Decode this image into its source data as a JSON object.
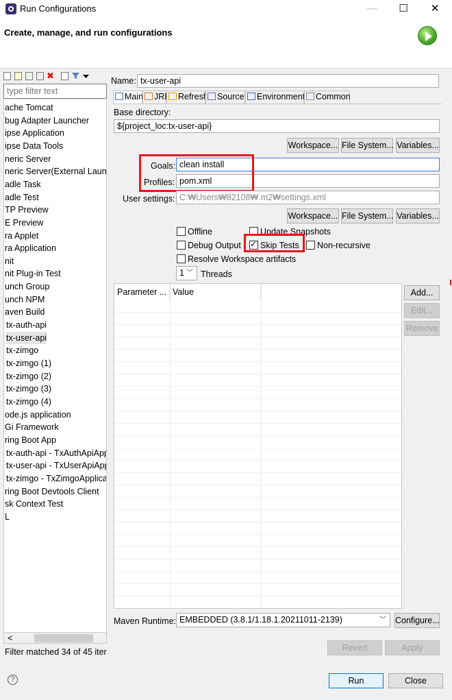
{
  "window": {
    "title": "Run Configurations",
    "min_glyph": "—",
    "max_glyph": "☐",
    "close_glyph": "✕"
  },
  "banner": {
    "heading": "Create, manage, and run configurations",
    "icon": "run-icon"
  },
  "left_panel": {
    "toolbar_icons": [
      "new-config-icon",
      "new-prototype-icon",
      "export-icon",
      "duplicate-icon",
      "delete-icon",
      "collapse-all-icon",
      "filter-icon",
      "view-menu-icon"
    ],
    "filter_placeholder": "type filter text",
    "tree_items": [
      "ache Tomcat",
      "bug Adapter Launcher",
      "ipse Application",
      "ipse Data Tools",
      "neric Server",
      "neric Server(External Launch",
      "adle Task",
      "adle Test",
      "TP Preview",
      "E Preview",
      "ra Applet",
      "ra Application",
      "nit",
      "nit Plug-in Test",
      "unch Group",
      "unch NPM",
      "aven Build",
      "tx-auth-api",
      "tx-user-api",
      "tx-zimgo",
      "tx-zimgo (1)",
      "tx-zimgo (2)",
      "tx-zimgo (3)",
      "tx-zimgo (4)",
      "ode.js application",
      "Gi Framework",
      "ring Boot App",
      "tx-auth-api - TxAuthApiApp",
      "tx-user-api - TxUserApiApp",
      "tx-zimgo - TxZimgoApplica",
      "ring Boot Devtools Client",
      "sk Context Test",
      "L"
    ],
    "selected_index": 18,
    "scroll_left_glyph": "<",
    "filter_status": "Filter matched 34 of 45 iter"
  },
  "config": {
    "name_label": "Name:",
    "name_value": "tx-user-api",
    "tabs": [
      {
        "label": "Main",
        "icon": "main-tab-icon"
      },
      {
        "label": "JRE",
        "icon": "jre-tab-icon"
      },
      {
        "label": "Refresh",
        "icon": "refresh-tab-icon"
      },
      {
        "label": "Source",
        "icon": "source-tab-icon"
      },
      {
        "label": "Environment",
        "icon": "environment-tab-icon"
      },
      {
        "label": "Common",
        "icon": "common-tab-icon"
      }
    ],
    "base_dir_label": "Base directory:",
    "base_dir_value": "${project_loc:tx-user-api}",
    "workspace_btn": "Workspace...",
    "filesystem_btn": "File System...",
    "variables_btn": "Variables...",
    "goals_label": "Goals:",
    "goals_value": "clean install",
    "profiles_label": "Profiles:",
    "profiles_value": "pom.xml",
    "user_settings_label": "User settings:",
    "user_settings_value": "C:₩Users₩82108₩.m2₩settings.xml",
    "workspace_btn2": "Workspace...",
    "filesystem_btn2": "File System...",
    "variables_btn2": "Variables...",
    "options": {
      "offline": {
        "label": "Offline",
        "checked": false
      },
      "update_snapshots": {
        "label": "Update Snapshots",
        "checked": false
      },
      "debug_output": {
        "label": "Debug Output",
        "checked": false
      },
      "skip_tests": {
        "label": "Skip Tests",
        "checked": true
      },
      "non_recursive": {
        "label": "Non-recursive",
        "checked": false
      },
      "resolve_workspace": {
        "label": "Resolve Workspace artifacts",
        "checked": false
      }
    },
    "threads_value": "1",
    "threads_label": "Threads",
    "param_table": {
      "headers": [
        "Parameter ...",
        "Value"
      ],
      "rows": []
    },
    "add_btn": "Add...",
    "edit_btn": "Edit...",
    "remove_btn": "Remove",
    "maven_runtime_label": "Maven Runtime:",
    "maven_runtime_value": "EMBEDDED (3.8.1/1.18.1.20211011-2139)",
    "configure_btn": "Configure...",
    "revert_btn": "Revert",
    "apply_btn": "Apply"
  },
  "footer": {
    "help_glyph": "?",
    "run_btn": "Run",
    "close_btn": "Close"
  },
  "colors": {
    "highlight_box": "#e3191f",
    "focus_border": "#3c7fd0",
    "primary_border": "#0078d7"
  }
}
